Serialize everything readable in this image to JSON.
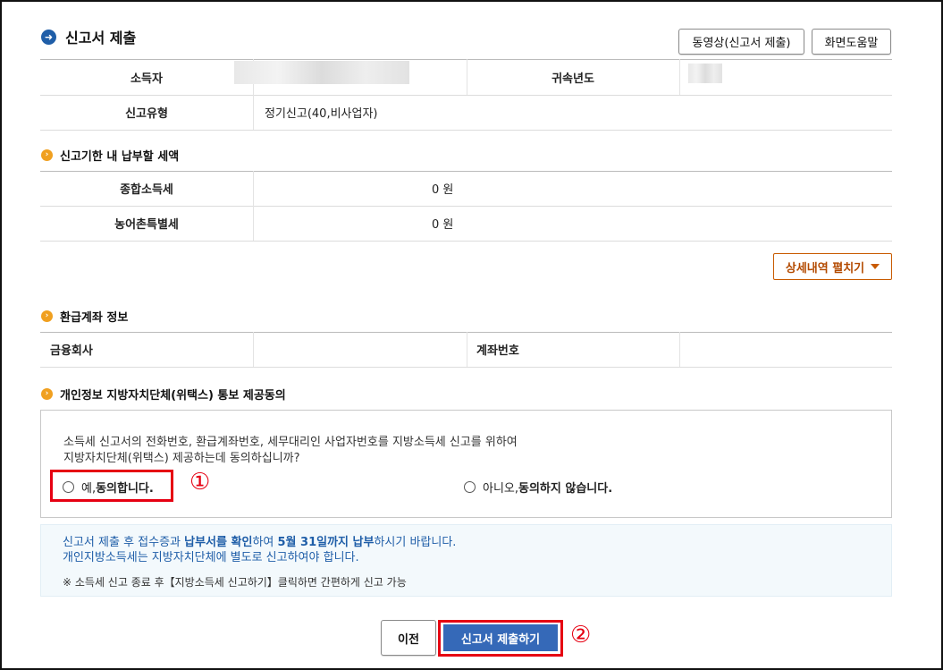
{
  "header": {
    "title": "신고서 제출",
    "video_button": "동영상(신고서 제출)",
    "help_button": "화면도움말"
  },
  "info_table": {
    "income_earner_label": "소득자",
    "tax_year_label": "귀속년도",
    "report_type_label": "신고유형",
    "report_type_value": "정기신고(40,비사업자)"
  },
  "tax_section": {
    "title": "신고기한 내 납부할 세액",
    "rows": [
      {
        "label": "종합소득세",
        "value": "0 원"
      },
      {
        "label": "농어촌특별세",
        "value": "0 원"
      }
    ],
    "detail_button": "상세내역 펼치기"
  },
  "refund_section": {
    "title": "환급계좌 정보",
    "bank_label": "금융회사",
    "account_label": "계좌번호"
  },
  "consent_section": {
    "title": "개인정보 지방자치단체(위택스) 통보 제공동의",
    "question_line1": "소득세 신고서의 전화번호, 환급계좌번호, 세무대리인 사업자번호를 지방소득세 신고를 위하여",
    "question_line2": "지방자치단체(위택스) 제공하는데 동의하십니까?",
    "yes_prefix": "예, ",
    "yes_bold": "동의합니다.",
    "no_prefix": "아니오, ",
    "no_bold": "동의하지 않습니다.",
    "marker1": "①"
  },
  "notice": {
    "line1_a": "신고서 제출 후 접수증과 ",
    "line1_b": "납부서를 확인",
    "line1_c": "하여 ",
    "line1_d": "5월 31일까지 납부",
    "line1_e": "하시기 바랍니다.",
    "line2": "개인지방소득세는 지방자치단체에 별도로 신고하여야 합니다.",
    "line3": "※ 소득세 신고 종료 후【지방소득세 신고하기】클릭하면 간편하게 신고 가능"
  },
  "footer": {
    "prev_button": "이전",
    "submit_button": "신고서 제출하기",
    "marker2": "②"
  },
  "colors": {
    "accent_blue": "#3569b8",
    "highlight_red": "#e60012",
    "section_orange": "#f0a020"
  }
}
